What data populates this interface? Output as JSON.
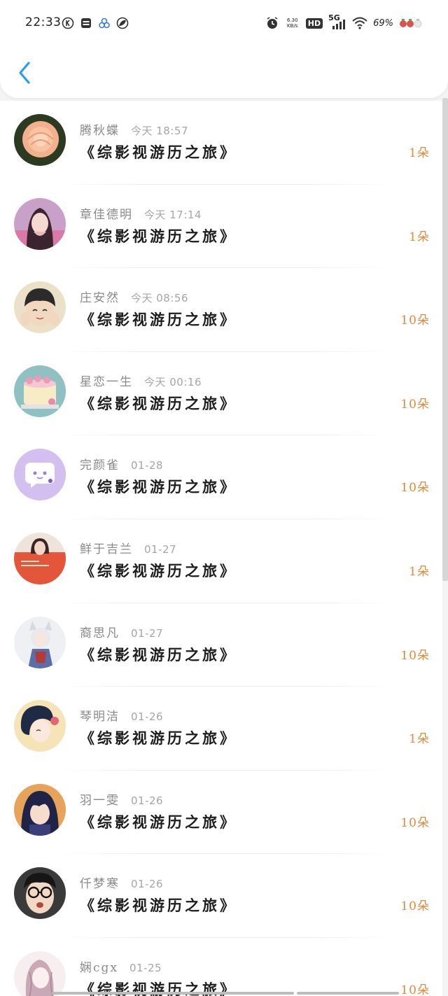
{
  "status_bar": {
    "time": "22:33",
    "net_speed": "6.30 KB/s",
    "hd": "HD",
    "network": "5G",
    "battery": "69%"
  },
  "header": {
    "back_icon": "chevron-left-icon"
  },
  "colors": {
    "accent_blue": "#2a9ee8",
    "count_orange": "#e08a3c"
  },
  "list": {
    "items": [
      {
        "name": "腾秋蝶",
        "time": "今天 18:57",
        "book": "《综影视游历之旅》",
        "count": "1朵"
      },
      {
        "name": "章佳德明",
        "time": "今天 17:14",
        "book": "《综影视游历之旅》",
        "count": "1朵"
      },
      {
        "name": "庄安然",
        "time": "今天 08:56",
        "book": "《综影视游历之旅》",
        "count": "10朵"
      },
      {
        "name": "星恋一生",
        "time": "今天 00:16",
        "book": "《综影视游历之旅》",
        "count": "10朵"
      },
      {
        "name": "完颜雀",
        "time": "01-28",
        "book": "《综影视游历之旅》",
        "count": "10朵"
      },
      {
        "name": "鲜于吉兰",
        "time": "01-27",
        "book": "《综影视游历之旅》",
        "count": "1朵"
      },
      {
        "name": "裔思凡",
        "time": "01-27",
        "book": "《综影视游历之旅》",
        "count": "10朵"
      },
      {
        "name": "琴明洁",
        "time": "01-26",
        "book": "《综影视游历之旅》",
        "count": "1朵"
      },
      {
        "name": "羽一雯",
        "time": "01-26",
        "book": "《综影视游历之旅》",
        "count": "10朵"
      },
      {
        "name": "仟梦寒",
        "time": "01-26",
        "book": "《综影视游历之旅》",
        "count": "10朵"
      },
      {
        "name": "娴cgx",
        "time": "01-25",
        "book": "《综影视游历之旅》",
        "count": "10朵"
      }
    ]
  }
}
